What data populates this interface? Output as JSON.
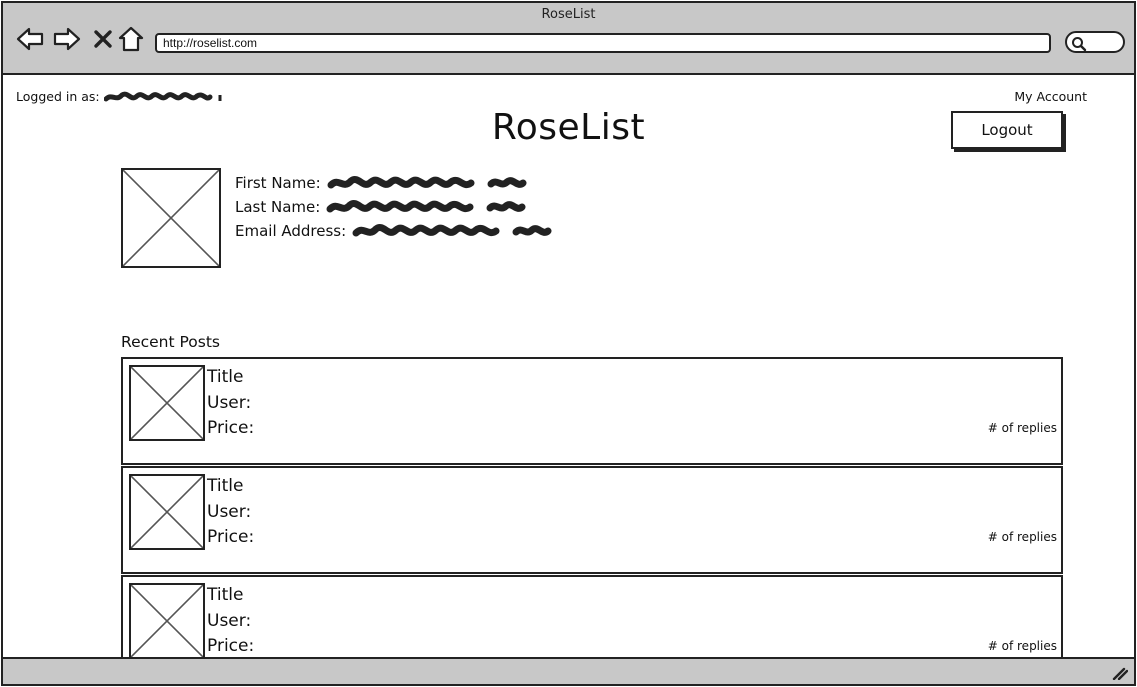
{
  "window": {
    "title": "RoseList"
  },
  "browser": {
    "url": "http://roselist.com",
    "buttons": {
      "back": "back-arrow",
      "forward": "forward-arrow",
      "stop": "close-x",
      "home": "home"
    }
  },
  "header": {
    "logged_in_label": "Logged in as:",
    "my_account": "My Account",
    "site_title": "RoseList",
    "logout": "Logout"
  },
  "profile": {
    "fields": [
      {
        "label": "First Name:"
      },
      {
        "label": "Last Name:"
      },
      {
        "label": "Email Address:"
      }
    ]
  },
  "recent": {
    "label": "Recent Posts",
    "posts": [
      {
        "title": "Title",
        "user": "User:",
        "price": "Price:",
        "replies": "# of replies"
      },
      {
        "title": "Title",
        "user": "User:",
        "price": "Price:",
        "replies": "# of replies"
      },
      {
        "title": "Title",
        "user": "User:",
        "price": "Price:",
        "replies": "# of replies"
      }
    ]
  }
}
